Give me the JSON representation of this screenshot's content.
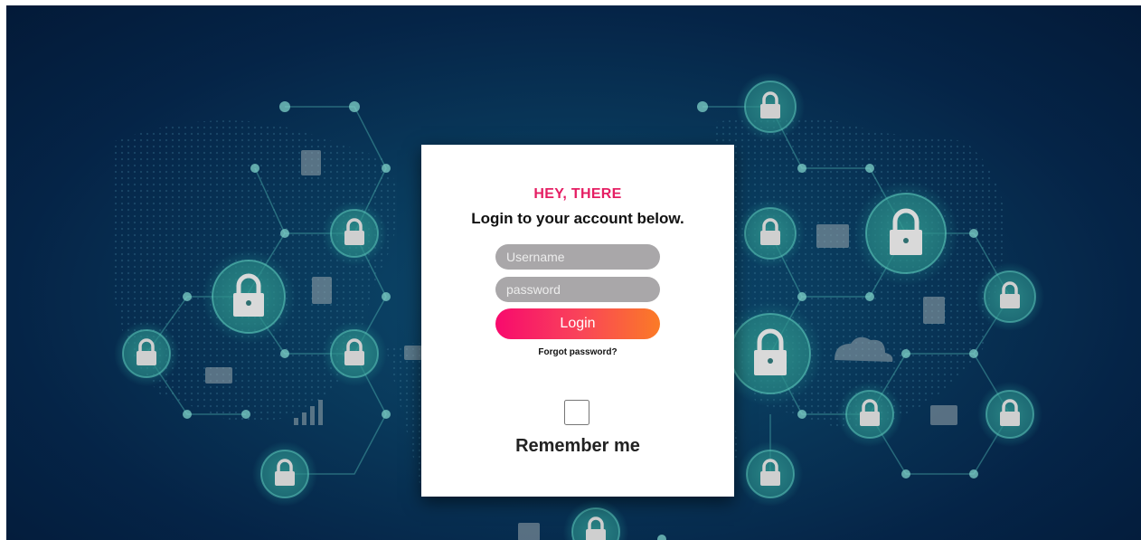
{
  "login_card": {
    "greeting": "HEY, THERE",
    "subtitle": "Login to your account below.",
    "username_placeholder": "Username",
    "password_placeholder": "password",
    "login_button": "Login",
    "forgot_password": "Forgot password?",
    "remember_me": "Remember me",
    "remember_checked": false
  },
  "colors": {
    "greeting": "#e51e63",
    "button_gradient_start": "#f80a6d",
    "button_gradient_end": "#fb7b26",
    "input_background": "#a9a7a9",
    "background_dark": "#031a38",
    "network_accent": "#2a9c92"
  },
  "background": {
    "theme": "cyber-security network",
    "icons": [
      "lock-icon",
      "document-icon",
      "folder-icon",
      "cloud-icon",
      "bar-chart-icon",
      "video-icon"
    ]
  }
}
